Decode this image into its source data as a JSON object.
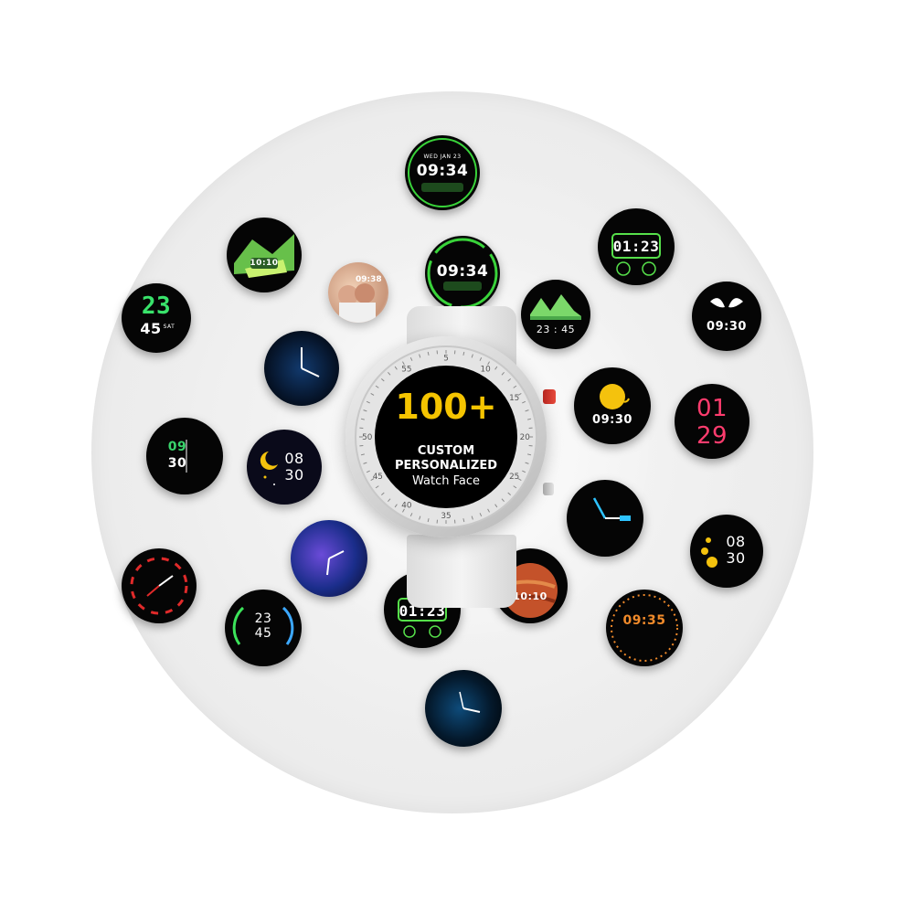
{
  "promo": {
    "count": "100+",
    "line1": "CUSTOM",
    "line2": "PERSONALIZED",
    "line3": "Watch Face"
  },
  "bezel_numbers": [
    "55",
    "5",
    "10",
    "15",
    "20",
    "25",
    "35",
    "40",
    "45",
    "50"
  ],
  "faces": {
    "top_green": "09:34",
    "top_green_date": "WED  JAN 23",
    "second_green": "09:34",
    "green_digital_tr": "01:23",
    "green_digital_bottom": "01:23",
    "landscape_time": "23 : 45",
    "venom_time": "09:30",
    "sun_time": "09:30",
    "left_big_top": "23",
    "left_big_bottom": "45",
    "left_sat": "SAT",
    "left_mid_hh": "09",
    "left_mid_mm": "30",
    "moon_time_h": "08",
    "moon_time_m": "30",
    "pink_top": "01",
    "pink_bottom": "29",
    "yellow_h": "08",
    "yellow_m": "30",
    "orange_time": "09:35",
    "arc_h": "23",
    "arc_m": "45",
    "mars_time": "10:10",
    "hills_time": "10:10",
    "photo_time": "09:38"
  }
}
